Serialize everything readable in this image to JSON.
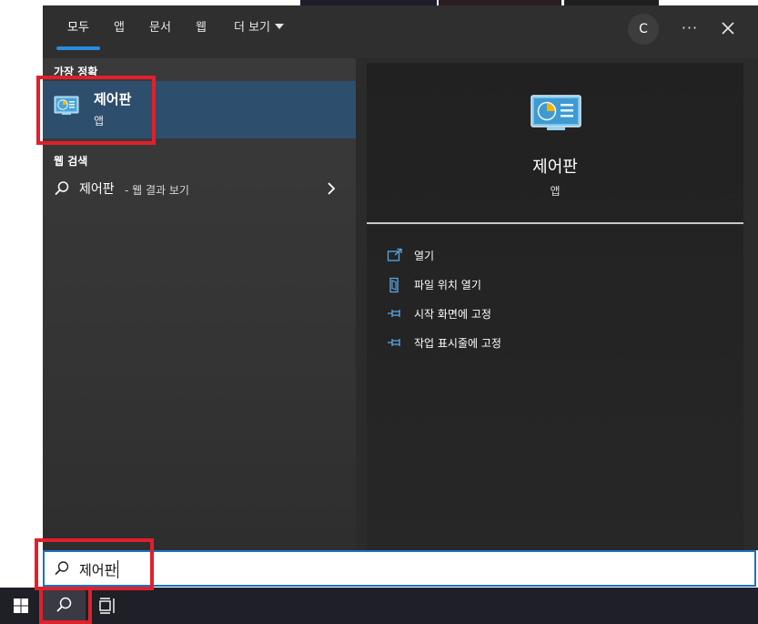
{
  "tabs": [
    {
      "label": "모두"
    },
    {
      "label": "앱"
    },
    {
      "label": "문서"
    },
    {
      "label": "웹"
    },
    {
      "label": "더 보기"
    }
  ],
  "account": {
    "initial": "C"
  },
  "more_label": "···",
  "best_match": {
    "section_label": "가장 정확",
    "name": "제어판",
    "type": "앱"
  },
  "web_search": {
    "section_label": "웹 검색",
    "query": "제어판",
    "suffix": "- 웹 결과 보기"
  },
  "preview": {
    "name": "제어판",
    "type": "앱",
    "actions": [
      {
        "label": "열기",
        "icon": "open-icon"
      },
      {
        "label": "파일 위치 열기",
        "icon": "file-location-icon"
      },
      {
        "label": "시작 화면에 고정",
        "icon": "pin-icon"
      },
      {
        "label": "작업 표시줄에 고정",
        "icon": "pin-icon"
      }
    ]
  },
  "search": {
    "value": "제어판"
  },
  "colors": {
    "accent": "#2b8be0",
    "selection": "#2e4e6e",
    "highlight": "#e0202a"
  }
}
